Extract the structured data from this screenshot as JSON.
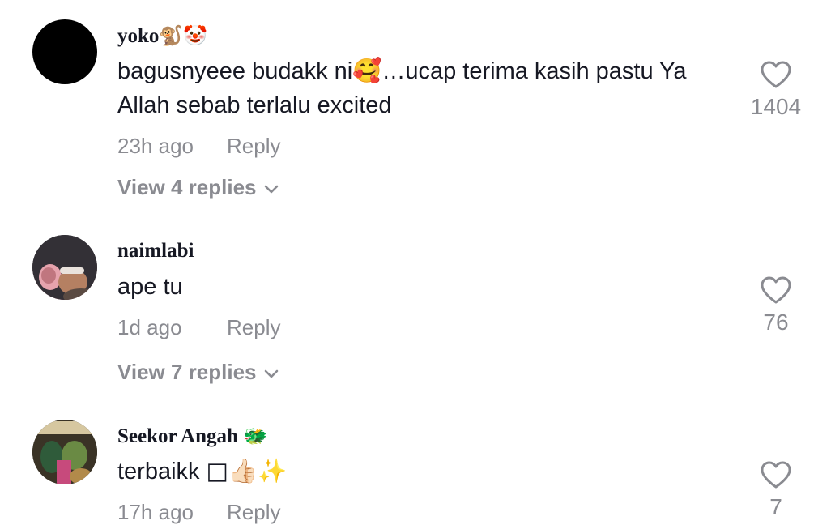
{
  "comments": [
    {
      "username": "yoko",
      "username_emoji": "🐒🤡",
      "text_before": "bagusnyeee budakk ni",
      "text_emoji": "🥰",
      "text_after": "…ucap terima kasih pastu Ya Allah sebab terlalu excited",
      "time": "23h ago",
      "reply_label": "Reply",
      "view_replies": "View 4 replies",
      "likes": "1404"
    },
    {
      "username": "naimlabi",
      "username_emoji": "",
      "text_before": "ape tu",
      "text_emoji": "",
      "text_after": "",
      "time": "1d ago",
      "reply_label": "Reply",
      "view_replies": "View 7 replies",
      "likes": "76"
    },
    {
      "username": "Seekor Angah",
      "username_emoji": "🐲",
      "text_before": "terbaikk ",
      "text_emoji": "□👍🏻✨",
      "text_after": "",
      "time": "17h ago",
      "reply_label": "Reply",
      "view_replies": "",
      "likes": "7"
    }
  ],
  "colors": {
    "text": "#161823",
    "muted": "#8a8b91"
  },
  "icons": {
    "like": "heart-outline-icon",
    "expand": "chevron-down-icon"
  }
}
